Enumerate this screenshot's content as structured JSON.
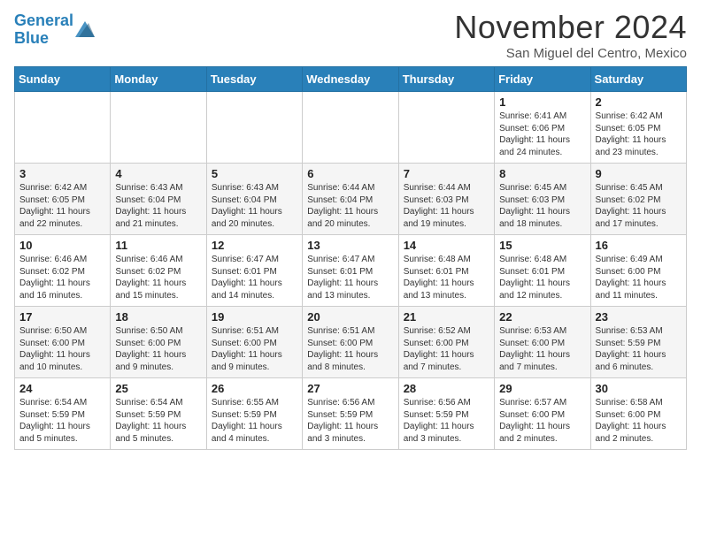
{
  "header": {
    "logo_line1": "General",
    "logo_line2": "Blue",
    "month": "November 2024",
    "location": "San Miguel del Centro, Mexico"
  },
  "weekdays": [
    "Sunday",
    "Monday",
    "Tuesday",
    "Wednesday",
    "Thursday",
    "Friday",
    "Saturday"
  ],
  "weeks": [
    [
      {
        "day": "",
        "info": ""
      },
      {
        "day": "",
        "info": ""
      },
      {
        "day": "",
        "info": ""
      },
      {
        "day": "",
        "info": ""
      },
      {
        "day": "",
        "info": ""
      },
      {
        "day": "1",
        "info": "Sunrise: 6:41 AM\nSunset: 6:06 PM\nDaylight: 11 hours\nand 24 minutes."
      },
      {
        "day": "2",
        "info": "Sunrise: 6:42 AM\nSunset: 6:05 PM\nDaylight: 11 hours\nand 23 minutes."
      }
    ],
    [
      {
        "day": "3",
        "info": "Sunrise: 6:42 AM\nSunset: 6:05 PM\nDaylight: 11 hours\nand 22 minutes."
      },
      {
        "day": "4",
        "info": "Sunrise: 6:43 AM\nSunset: 6:04 PM\nDaylight: 11 hours\nand 21 minutes."
      },
      {
        "day": "5",
        "info": "Sunrise: 6:43 AM\nSunset: 6:04 PM\nDaylight: 11 hours\nand 20 minutes."
      },
      {
        "day": "6",
        "info": "Sunrise: 6:44 AM\nSunset: 6:04 PM\nDaylight: 11 hours\nand 20 minutes."
      },
      {
        "day": "7",
        "info": "Sunrise: 6:44 AM\nSunset: 6:03 PM\nDaylight: 11 hours\nand 19 minutes."
      },
      {
        "day": "8",
        "info": "Sunrise: 6:45 AM\nSunset: 6:03 PM\nDaylight: 11 hours\nand 18 minutes."
      },
      {
        "day": "9",
        "info": "Sunrise: 6:45 AM\nSunset: 6:02 PM\nDaylight: 11 hours\nand 17 minutes."
      }
    ],
    [
      {
        "day": "10",
        "info": "Sunrise: 6:46 AM\nSunset: 6:02 PM\nDaylight: 11 hours\nand 16 minutes."
      },
      {
        "day": "11",
        "info": "Sunrise: 6:46 AM\nSunset: 6:02 PM\nDaylight: 11 hours\nand 15 minutes."
      },
      {
        "day": "12",
        "info": "Sunrise: 6:47 AM\nSunset: 6:01 PM\nDaylight: 11 hours\nand 14 minutes."
      },
      {
        "day": "13",
        "info": "Sunrise: 6:47 AM\nSunset: 6:01 PM\nDaylight: 11 hours\nand 13 minutes."
      },
      {
        "day": "14",
        "info": "Sunrise: 6:48 AM\nSunset: 6:01 PM\nDaylight: 11 hours\nand 13 minutes."
      },
      {
        "day": "15",
        "info": "Sunrise: 6:48 AM\nSunset: 6:01 PM\nDaylight: 11 hours\nand 12 minutes."
      },
      {
        "day": "16",
        "info": "Sunrise: 6:49 AM\nSunset: 6:00 PM\nDaylight: 11 hours\nand 11 minutes."
      }
    ],
    [
      {
        "day": "17",
        "info": "Sunrise: 6:50 AM\nSunset: 6:00 PM\nDaylight: 11 hours\nand 10 minutes."
      },
      {
        "day": "18",
        "info": "Sunrise: 6:50 AM\nSunset: 6:00 PM\nDaylight: 11 hours\nand 9 minutes."
      },
      {
        "day": "19",
        "info": "Sunrise: 6:51 AM\nSunset: 6:00 PM\nDaylight: 11 hours\nand 9 minutes."
      },
      {
        "day": "20",
        "info": "Sunrise: 6:51 AM\nSunset: 6:00 PM\nDaylight: 11 hours\nand 8 minutes."
      },
      {
        "day": "21",
        "info": "Sunrise: 6:52 AM\nSunset: 6:00 PM\nDaylight: 11 hours\nand 7 minutes."
      },
      {
        "day": "22",
        "info": "Sunrise: 6:53 AM\nSunset: 6:00 PM\nDaylight: 11 hours\nand 7 minutes."
      },
      {
        "day": "23",
        "info": "Sunrise: 6:53 AM\nSunset: 5:59 PM\nDaylight: 11 hours\nand 6 minutes."
      }
    ],
    [
      {
        "day": "24",
        "info": "Sunrise: 6:54 AM\nSunset: 5:59 PM\nDaylight: 11 hours\nand 5 minutes."
      },
      {
        "day": "25",
        "info": "Sunrise: 6:54 AM\nSunset: 5:59 PM\nDaylight: 11 hours\nand 5 minutes."
      },
      {
        "day": "26",
        "info": "Sunrise: 6:55 AM\nSunset: 5:59 PM\nDaylight: 11 hours\nand 4 minutes."
      },
      {
        "day": "27",
        "info": "Sunrise: 6:56 AM\nSunset: 5:59 PM\nDaylight: 11 hours\nand 3 minutes."
      },
      {
        "day": "28",
        "info": "Sunrise: 6:56 AM\nSunset: 5:59 PM\nDaylight: 11 hours\nand 3 minutes."
      },
      {
        "day": "29",
        "info": "Sunrise: 6:57 AM\nSunset: 6:00 PM\nDaylight: 11 hours\nand 2 minutes."
      },
      {
        "day": "30",
        "info": "Sunrise: 6:58 AM\nSunset: 6:00 PM\nDaylight: 11 hours\nand 2 minutes."
      }
    ]
  ]
}
